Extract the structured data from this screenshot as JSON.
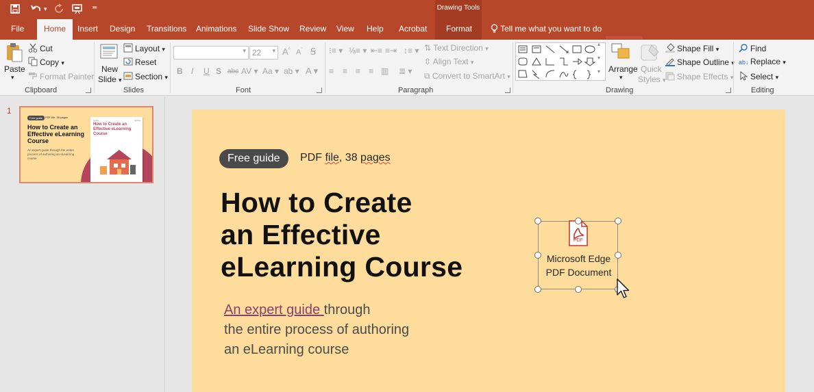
{
  "titlebar": {
    "context_header": "Drawing Tools",
    "quick_access": [
      "save-icon",
      "undo-icon",
      "redo-icon",
      "present-icon",
      "customize-icon"
    ]
  },
  "tabs": {
    "file": "File",
    "home": "Home",
    "insert": "Insert",
    "design": "Design",
    "transitions": "Transitions",
    "animations": "Animations",
    "slide_show": "Slide Show",
    "review": "Review",
    "view": "View",
    "help": "Help",
    "acrobat": "Acrobat",
    "format": "Format",
    "tell_me": "Tell me what you want to do"
  },
  "ribbon": {
    "clipboard": {
      "label": "Clipboard",
      "paste": "Paste",
      "cut": "Cut",
      "copy": "Copy",
      "format_painter": "Format Painter"
    },
    "slides": {
      "label": "Slides",
      "new_slide_1": "New",
      "new_slide_2": "Slide",
      "layout": "Layout",
      "reset": "Reset",
      "section": "Section"
    },
    "font": {
      "label": "Font",
      "font_size": "22"
    },
    "paragraph": {
      "label": "Paragraph",
      "text_direction": "Text Direction",
      "align_text": "Align Text",
      "convert_smartart": "Convert to SmartArt"
    },
    "drawing": {
      "label": "Drawing",
      "arrange": "Arrange",
      "quick_styles_1": "Quick",
      "quick_styles_2": "Styles",
      "shape_fill": "Shape Fill",
      "shape_outline": "Shape Outline",
      "shape_effects": "Shape Effects"
    },
    "editing": {
      "label": "Editing",
      "find": "Find",
      "replace": "Replace",
      "select": "Select"
    }
  },
  "thumbnail": {
    "number": "1",
    "pill": "Free guide",
    "pdf": "PDF file, 38 pages",
    "title": "How to Create an Effective eLearning Course",
    "sub": "An expert guide through the entire process of authoring an eLearning course",
    "cover_tag": "Guide",
    "cover_title": "How to Create an Effective eLearning Course",
    "cover_brand": "ispring"
  },
  "slide": {
    "pill": "Free guide",
    "pdf_prefix": "PDF ",
    "pdf_file": "file",
    "pdf_mid": ", 38 ",
    "pdf_pages": "pages",
    "title_1": "How to Create",
    "title_2": "an Effective",
    "title_3": "eLearning Course",
    "sub_link": "An expert guide ",
    "sub_1": "through",
    "sub_2": "the entire process of authoring",
    "sub_3": "an eLearning course",
    "object": {
      "icon_label": "PDF",
      "line_1": "Microsoft Edge",
      "line_2": "PDF Document"
    }
  },
  "colors": {
    "accent": "#b7472a",
    "slide_bg": "#fedd9c",
    "pill_bg": "#4a4a4a",
    "link": "#8a3e6e"
  }
}
